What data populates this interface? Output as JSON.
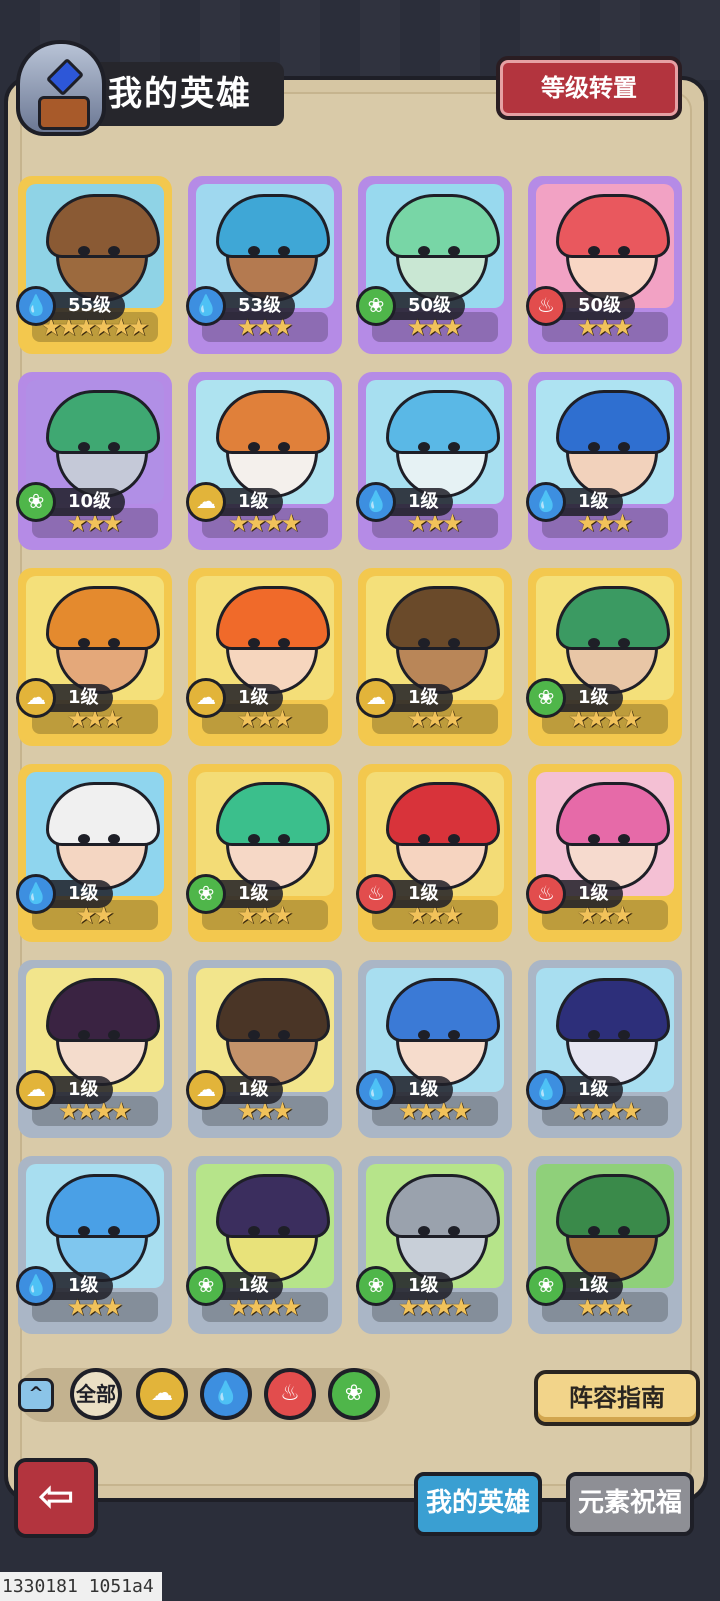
{
  "header": {
    "title": "我的英雄",
    "reset_button": "等级转置"
  },
  "heroes": [
    {
      "element": "water",
      "level": "55级",
      "stars": 6,
      "frame": "gold",
      "bg": "#8fd3e6",
      "hair": "#8a5a34",
      "skin": "#9c6a3e"
    },
    {
      "element": "water",
      "level": "53级",
      "stars": 3,
      "frame": "purple",
      "bg": "#9fd8ef",
      "hair": "#3fa7d6",
      "skin": "#b47a50"
    },
    {
      "element": "wood",
      "level": "50级",
      "stars": 3,
      "frame": "purple",
      "bg": "#98d9ee",
      "hair": "#78d6a6",
      "skin": "#c9e7d3"
    },
    {
      "element": "fire",
      "level": "50级",
      "stars": 3,
      "frame": "purple",
      "bg": "#f2a2c4",
      "hair": "#e9585e",
      "skin": "#f8d6c4"
    },
    {
      "element": "wood",
      "level": "10级",
      "stars": 3,
      "frame": "purple",
      "bg": "#b18fe6",
      "hair": "#3fa872",
      "skin": "#c5c9d8"
    },
    {
      "element": "earth",
      "level": "1级",
      "stars": 4,
      "frame": "purple",
      "bg": "#aee3f0",
      "hair": "#e0803a",
      "skin": "#f4f0ec"
    },
    {
      "element": "water",
      "level": "1级",
      "stars": 3,
      "frame": "purple",
      "bg": "#a7dff0",
      "hair": "#5ab8e6",
      "skin": "#e6f2f4"
    },
    {
      "element": "water",
      "level": "1级",
      "stars": 3,
      "frame": "purple",
      "bg": "#aee3f2",
      "hair": "#2f6fd0",
      "skin": "#f2d2bc"
    },
    {
      "element": "earth",
      "level": "1级",
      "stars": 3,
      "frame": "gold",
      "bg": "#f4e07a",
      "hair": "#e48a2e",
      "skin": "#e4a87a"
    },
    {
      "element": "earth",
      "level": "1级",
      "stars": 3,
      "frame": "gold",
      "bg": "#f4de78",
      "hair": "#f06a2a",
      "skin": "#f6d6be"
    },
    {
      "element": "earth",
      "level": "1级",
      "stars": 3,
      "frame": "gold",
      "bg": "#f4e07a",
      "hair": "#6a4a2a",
      "skin": "#b98658"
    },
    {
      "element": "wood",
      "level": "1级",
      "stars": 4,
      "frame": "gold",
      "bg": "#f4e07a",
      "hair": "#3b9a62",
      "skin": "#e8c6a6"
    },
    {
      "element": "water",
      "level": "1级",
      "stars": 2,
      "frame": "gold",
      "bg": "#8fd5ee",
      "hair": "#f0f0f0",
      "skin": "#f4d6c2"
    },
    {
      "element": "wood",
      "level": "1级",
      "stars": 3,
      "frame": "gold",
      "bg": "#f3dc76",
      "hair": "#3bbf8c",
      "skin": "#f6d8c6"
    },
    {
      "element": "fire",
      "level": "1级",
      "stars": 3,
      "frame": "gold",
      "bg": "#f3dc76",
      "hair": "#d8333a",
      "skin": "#f6d4c0"
    },
    {
      "element": "fire",
      "level": "1级",
      "stars": 3,
      "frame": "gold",
      "bg": "#f4c0d4",
      "hair": "#e66aa8",
      "skin": "#f6dace"
    },
    {
      "element": "earth",
      "level": "1级",
      "stars": 4,
      "frame": "silver",
      "bg": "#f2e58c",
      "hair": "#3a2342",
      "skin": "#f4dccc"
    },
    {
      "element": "earth",
      "level": "1级",
      "stars": 3,
      "frame": "silver",
      "bg": "#f2e58c",
      "hair": "#4a3526",
      "skin": "#c4936a"
    },
    {
      "element": "water",
      "level": "1级",
      "stars": 4,
      "frame": "silver",
      "bg": "#a8def0",
      "hair": "#3b7ad6",
      "skin": "#f6dccc"
    },
    {
      "element": "water",
      "level": "1级",
      "stars": 4,
      "frame": "silver",
      "bg": "#a8def0",
      "hair": "#2d2f7a",
      "skin": "#e6e6f2"
    },
    {
      "element": "water",
      "level": "1级",
      "stars": 3,
      "frame": "silver",
      "bg": "#a8def0",
      "hair": "#4aa0e6",
      "skin": "#7fc6ee"
    },
    {
      "element": "wood",
      "level": "1级",
      "stars": 4,
      "frame": "silver",
      "bg": "#b6e48a",
      "hair": "#3b2e5e",
      "skin": "#e8e27a"
    },
    {
      "element": "wood",
      "level": "1级",
      "stars": 4,
      "frame": "silver",
      "bg": "#b6e48a",
      "hair": "#9aa2ad",
      "skin": "#c8cfd8"
    },
    {
      "element": "wood",
      "level": "1级",
      "stars": 3,
      "frame": "silver",
      "bg": "#8fd07a",
      "hair": "#3a8a4a",
      "skin": "#a8783e"
    }
  ],
  "filters": {
    "collapse_icon": "^",
    "all_label": "全部",
    "elements": [
      "earth",
      "water",
      "fire",
      "wood"
    ]
  },
  "element_colors": {
    "water": "#3d8fe0",
    "wood": "#4fb64a",
    "fire": "#e24d4d",
    "earth": "#e2b43a"
  },
  "frame_colors": {
    "gold": "#f3c84e",
    "purple": "#b58be6",
    "silver": "#aab6c6"
  },
  "guide_button": "阵容指南",
  "back_button_icon": "back-arrow-icon",
  "tabs": {
    "active": "我的英雄",
    "inactive": "元素祝福"
  },
  "footer_id": "1330181 1051a4"
}
